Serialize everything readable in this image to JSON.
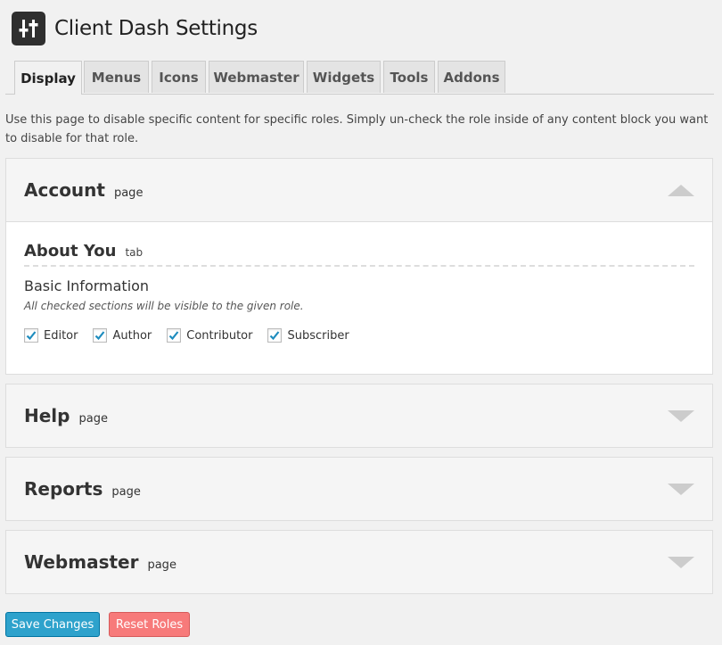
{
  "header": {
    "title": "Client Dash Settings",
    "logo_icon": "sliders-icon"
  },
  "tabs": [
    {
      "label": "Display",
      "active": true
    },
    {
      "label": "Menus"
    },
    {
      "label": "Icons"
    },
    {
      "label": "Webmaster"
    },
    {
      "label": "Widgets"
    },
    {
      "label": "Tools"
    },
    {
      "label": "Addons"
    }
  ],
  "intro": "Use this page to disable specific content for specific roles. Simply un-check the role inside of any content block you want to disable for that role.",
  "panels": [
    {
      "title": "Account",
      "type": "page",
      "expanded": true,
      "tab": {
        "title": "About You",
        "type": "tab"
      },
      "section": {
        "title": "Basic Information",
        "note": "All checked sections will be visible to the given role.",
        "roles": [
          {
            "label": "Editor",
            "checked": true
          },
          {
            "label": "Author",
            "checked": true
          },
          {
            "label": "Contributor",
            "checked": true
          },
          {
            "label": "Subscriber",
            "checked": true
          }
        ]
      }
    },
    {
      "title": "Help",
      "type": "page"
    },
    {
      "title": "Reports",
      "type": "page"
    },
    {
      "title": "Webmaster",
      "type": "page"
    }
  ],
  "buttons": {
    "save": "Save Changes",
    "reset": "Reset Roles"
  },
  "colors": {
    "primary": "#2ea2cc",
    "danger": "#f77a7a",
    "check": "#1e8cbe"
  }
}
